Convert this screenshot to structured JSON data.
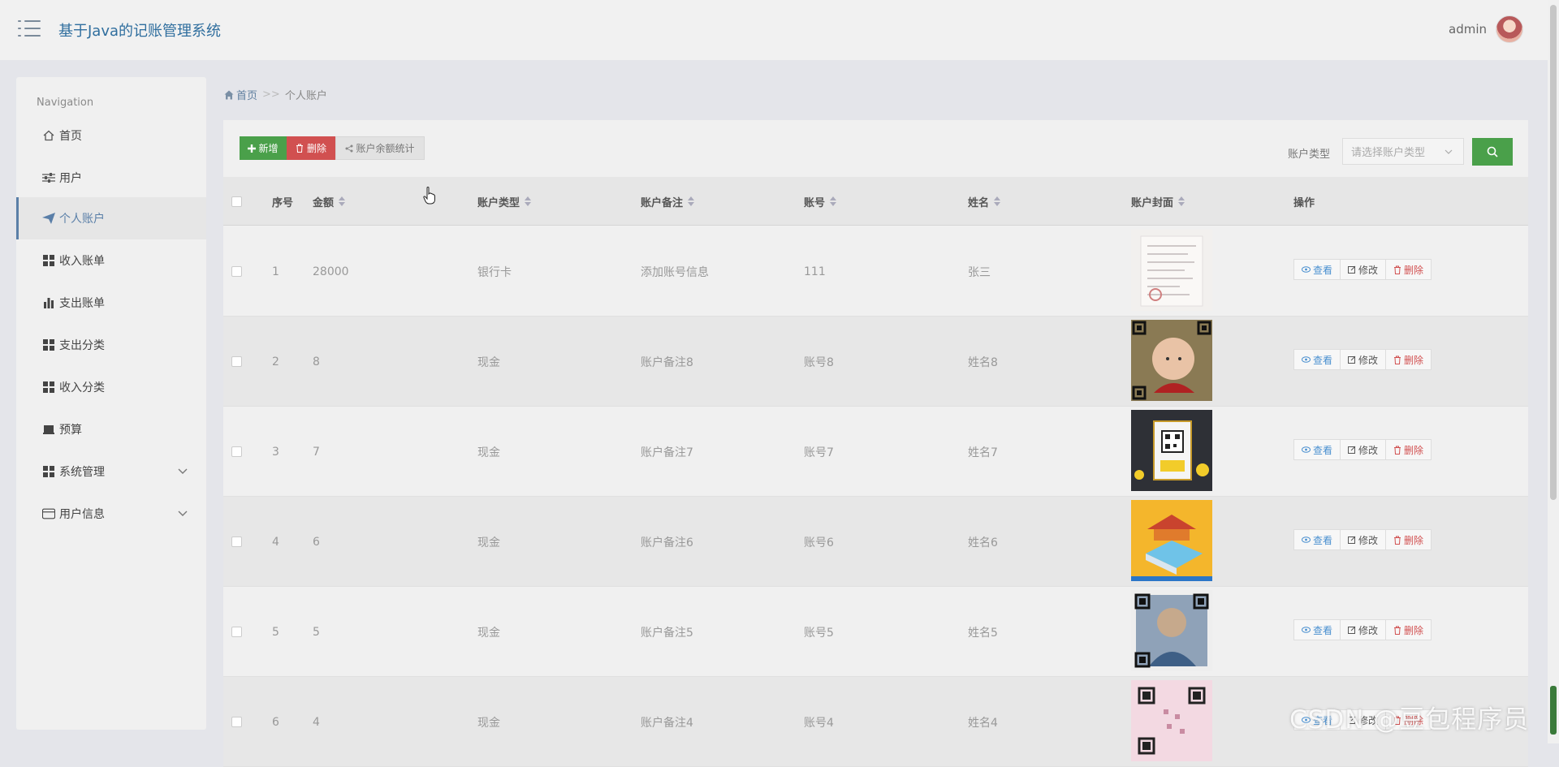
{
  "app": {
    "title": "基于Java的记账管理系统",
    "user": "admin"
  },
  "sidebar": {
    "heading": "Navigation",
    "items": [
      {
        "label": "首页",
        "icon": "home-icon"
      },
      {
        "label": "用户",
        "icon": "sliders-icon"
      },
      {
        "label": "个人账户",
        "icon": "paper-plane-icon",
        "active": true
      },
      {
        "label": "收入账单",
        "icon": "grid-icon"
      },
      {
        "label": "支出账单",
        "icon": "bar-chart-icon"
      },
      {
        "label": "支出分类",
        "icon": "grid-icon"
      },
      {
        "label": "收入分类",
        "icon": "grid-icon"
      },
      {
        "label": "预算",
        "icon": "drive-icon"
      },
      {
        "label": "系统管理",
        "icon": "grid-icon",
        "expandable": true
      },
      {
        "label": "用户信息",
        "icon": "card-icon",
        "expandable": true
      }
    ]
  },
  "breadcrumb": {
    "home": "首页",
    "separator": ">>",
    "current": "个人账户"
  },
  "toolbar": {
    "add": "新增",
    "delete": "删除",
    "stats": "账户余额统计"
  },
  "filter": {
    "label": "账户类型",
    "placeholder": "请选择账户类型"
  },
  "table": {
    "headers": [
      "序号",
      "金额",
      "账户类型",
      "账户备注",
      "账号",
      "姓名",
      "账户封面",
      "操作"
    ],
    "rows": [
      {
        "index": "1",
        "amount": "28000",
        "type": "银行卡",
        "note": "添加账号信息",
        "account": "111",
        "name": "张三"
      },
      {
        "index": "2",
        "amount": "8",
        "type": "现金",
        "note": "账户备注8",
        "account": "账号8",
        "name": "姓名8"
      },
      {
        "index": "3",
        "amount": "7",
        "type": "现金",
        "note": "账户备注7",
        "account": "账号7",
        "name": "姓名7"
      },
      {
        "index": "4",
        "amount": "6",
        "type": "现金",
        "note": "账户备注6",
        "account": "账号6",
        "name": "姓名6"
      },
      {
        "index": "5",
        "amount": "5",
        "type": "现金",
        "note": "账户备注5",
        "account": "账号5",
        "name": "姓名5"
      },
      {
        "index": "6",
        "amount": "4",
        "type": "现金",
        "note": "账户备注4",
        "account": "账号4",
        "name": "姓名4"
      }
    ],
    "actions": {
      "view": "查看",
      "edit": "修改",
      "delete": "删除"
    }
  },
  "watermark": "CSDN @豆包程序员",
  "colors": {
    "primary": "#4aa04a",
    "danger": "#d15050",
    "link": "#4a90d0",
    "title": "#2f6e9e"
  }
}
